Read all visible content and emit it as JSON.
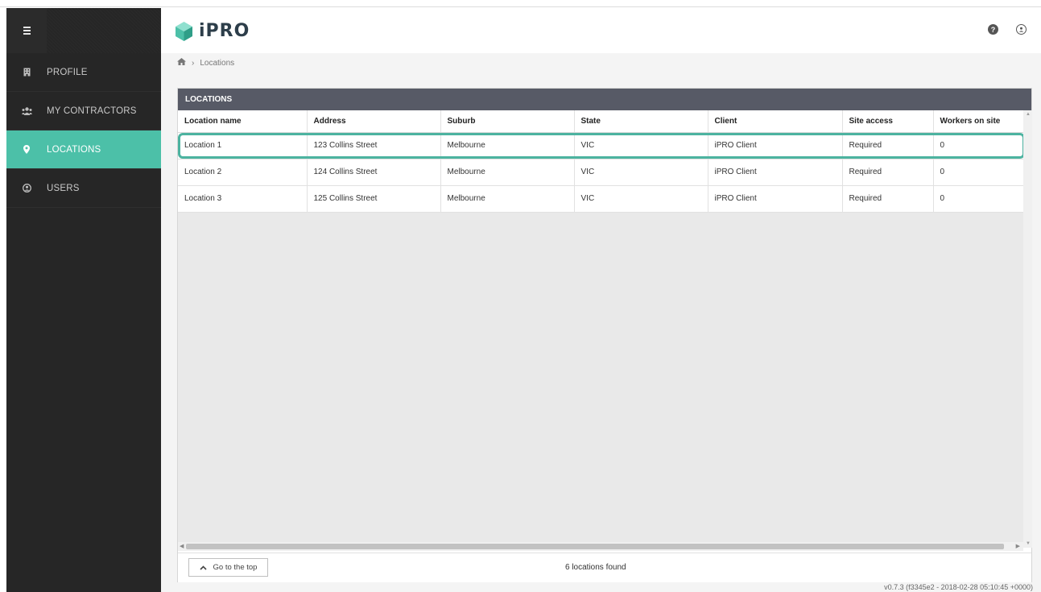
{
  "app": {
    "logo_text": "iPRO",
    "brand_color": "#4cc0a8"
  },
  "sidebar": {
    "items": [
      {
        "label": "PROFILE",
        "icon": "building-icon",
        "active": false
      },
      {
        "label": "MY CONTRACTORS",
        "icon": "group-icon",
        "active": false
      },
      {
        "label": "LOCATIONS",
        "icon": "map-pin-icon",
        "active": true
      },
      {
        "label": "USERS",
        "icon": "user-circle-icon",
        "active": false
      }
    ]
  },
  "header": {
    "help_icon": "question-circle-icon",
    "user_icon": "user-circle-icon"
  },
  "breadcrumb": {
    "home_icon": "home-icon",
    "separator": "›",
    "current": "Locations"
  },
  "panel": {
    "title": "LOCATIONS",
    "columns": [
      "Location name",
      "Address",
      "Suburb",
      "State",
      "Client",
      "Site access",
      "Workers on site"
    ],
    "rows": [
      [
        "Location 1",
        "123 Collins Street",
        "Melbourne",
        "VIC",
        "iPRO Client",
        "Required",
        "0"
      ],
      [
        "Location 2",
        "124 Collins Street",
        "Melbourne",
        "VIC",
        "iPRO Client",
        "Required",
        "0"
      ],
      [
        "Location 3",
        "125 Collins Street",
        "Melbourne",
        "VIC",
        "iPRO Client",
        "Required",
        "0"
      ]
    ],
    "highlight_color": "#4cb3a0"
  },
  "footer": {
    "top_button_label": "Go to the top",
    "count_text": "6 locations found"
  },
  "version": "v0.7.3 (f3345e2 - 2018-02-28 05:10:45 +0000)"
}
